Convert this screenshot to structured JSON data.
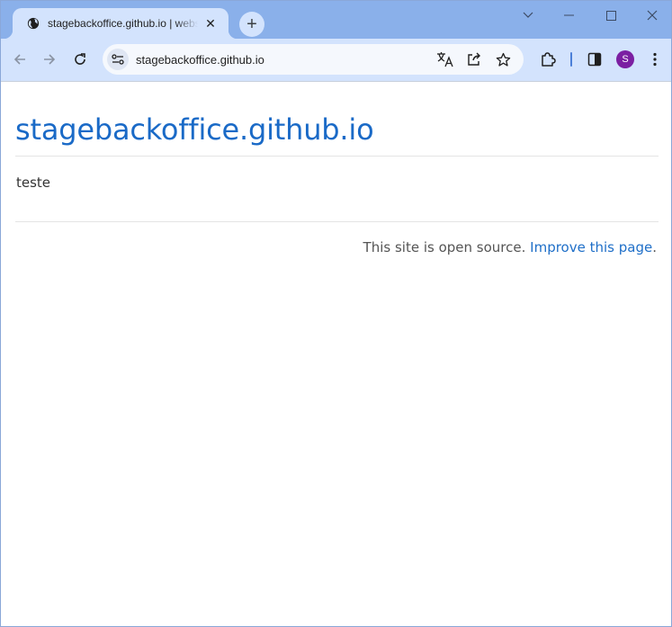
{
  "browser": {
    "tab": {
      "title": "stagebackoffice.github.io | website",
      "favicon": "globe-icon",
      "close_glyph": "✕"
    },
    "new_tab_glyph": "+",
    "window_controls": [
      "chevron-down-icon",
      "minimize-icon",
      "maximize-icon",
      "close-icon"
    ],
    "toolbar": {
      "url": "stagebackoffice.github.io",
      "avatar_initial": "S",
      "accent_color": "#8ab0ea",
      "toolbar_color": "#d3e3fd",
      "avatar_color": "#7b1fa2"
    }
  },
  "page": {
    "title": "stagebackoffice.github.io",
    "body": "teste",
    "footer": {
      "text": "This site is open source.",
      "link": "Improve this page",
      "suffix": "."
    },
    "link_color": "#1a6ac7"
  }
}
